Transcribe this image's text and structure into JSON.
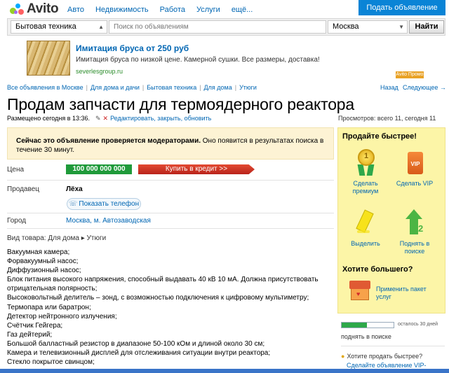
{
  "header": {
    "logo": "Avito",
    "nav": [
      "Авто",
      "Недвижимость",
      "Работа",
      "Услуги",
      "ещё..."
    ],
    "post_button": "Подать объявление"
  },
  "search": {
    "category": "Бытовая техника",
    "placeholder": "Поиск по объявлениям",
    "city": "Москва",
    "find_button": "Найти"
  },
  "banner": {
    "title": "Имитация бруса от 250 руб",
    "description": "Имитация бруса по низкой цене. Камерной сушки. Все размеры, доставка!",
    "url": "severlesgroup.ru",
    "tag": "Avito Промо"
  },
  "breadcrumbs": [
    "Все объявления в Москве",
    "Для дома и дачи",
    "Бытовая техника",
    "Для дома",
    "Утюги"
  ],
  "pager": {
    "back": "Назад",
    "next": "Следующее →"
  },
  "listing": {
    "title": "Продам запчасти для термоядерного реактора",
    "posted": "Размещено сегодня в 13:36.",
    "edit_link": "Редактировать, закрыть, обновить",
    "views": "Просмотров: всего 11, сегодня 11",
    "notice_bold": "Сейчас это объявление проверяется модераторами.",
    "notice_rest": " Оно появится в результатах поиска в течение 30 минут.",
    "price_label": "Цена",
    "price": "100 000 000 000 руб.",
    "credit_button": "Купить в кредит >>",
    "seller_label": "Продавец",
    "seller_name": "Лёха",
    "phone_button": "Показать телефон",
    "city_label": "Город",
    "city_value": "Москва, м. Автозаводская",
    "item_type": "Вид товара: Для дома ▸ Утюги",
    "description": [
      "Вакуумная камера;",
      "Форвакуумный насос;",
      "Диффузионный насос;",
      "Блок питания высокого напряжения, способный выдавать 40 кВ 10 мА. Должна присутствовать",
      "отрицательная полярность;",
      "Высоковольтный делитель – зонд, с возможностью подключения к цифровому мультиметру;",
      "Термопара или баратрон;",
      "Детектор нейтронного излучения;",
      "Счётчик Гейгера;",
      "Газ дейтерий;",
      "Большой балластный резистор в диапазоне 50-100 кОм и длиной около 30 см;",
      "Камера и телевизионный дисплей для отслеживания ситуации внутри реактора;",
      "Стекло покрытое свинцом;"
    ]
  },
  "sidebar": {
    "sell_faster": "Продайте быстрее!",
    "premium": "Сделать премиум",
    "vip": "Сделать VIP",
    "highlight": "Выделить",
    "raise": "Поднять в поиске",
    "want_more": "Хотите большего?",
    "package": "Применить пакет услуг",
    "progress_fraction": 0.48,
    "progress_text": "осталось 30 дней",
    "raised": "поднять в поиске",
    "question": "Хотите продать быстрее?",
    "question_link": "Сделайте объявление VIP-"
  },
  "colors": {
    "brand_blue": "#0a84d6",
    "price_green": "#1f9a3a",
    "credit_red": "#c9301f",
    "sidebar_yellow": "#fcf5a7",
    "notice_bg": "#fdf3d4"
  }
}
